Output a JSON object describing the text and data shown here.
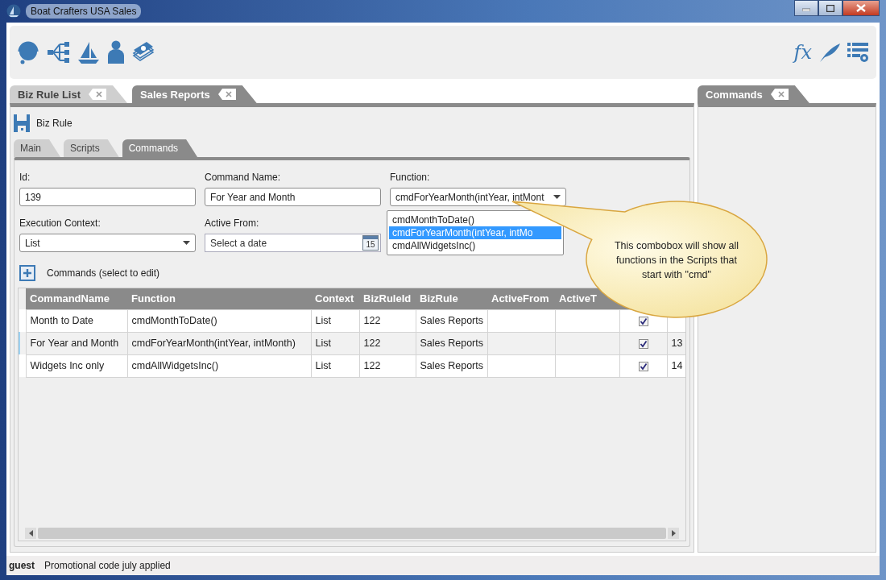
{
  "window": {
    "title": "Boat Crafters USA Sales"
  },
  "toolbar": {
    "formula_label": "fx"
  },
  "document_tabs": [
    {
      "label": "Biz Rule List",
      "selected": false
    },
    {
      "label": "Sales Reports",
      "selected": true
    }
  ],
  "panel_header": {
    "title": "Biz Rule"
  },
  "sub_tabs": [
    {
      "label": "Main",
      "selected": false
    },
    {
      "label": "Scripts",
      "selected": false
    },
    {
      "label": "Commands",
      "selected": true
    }
  ],
  "form": {
    "fields": [
      {
        "kind": "text",
        "label": "Id:",
        "value": "139"
      },
      {
        "kind": "text",
        "label": "Command Name:",
        "value": "For Year and Month"
      },
      {
        "kind": "combo",
        "label": "Function:",
        "value": "cmdForYearMonth(intYear, intMont"
      },
      {
        "kind": "combo",
        "label": "Execution Context:",
        "value": "List"
      },
      {
        "kind": "date",
        "label": "Active From:",
        "placeholder": "Select a date",
        "calendar_day": "15"
      }
    ],
    "function_options": [
      {
        "label": "cmdMonthToDate()",
        "selected": false
      },
      {
        "label": "cmdForYearMonth(intYear, intMo",
        "selected": true
      },
      {
        "label": "cmdAllWidgetsInc()",
        "selected": false
      }
    ]
  },
  "commands": {
    "title": "Commands (select to edit)",
    "columns": [
      "CommandName",
      "Function",
      "Context",
      "BizRuleId",
      "BizRule",
      "ActiveFrom",
      "ActiveT"
    ],
    "rows": [
      {
        "command_name": "Month to Date",
        "function": "cmdMonthToDate()",
        "context": "List",
        "biz_rule_id": "122",
        "biz_rule": "Sales Reports",
        "checked": true,
        "selected": false
      },
      {
        "command_name": "For Year and Month",
        "function": "cmdForYearMonth(intYear, intMonth)",
        "context": "List",
        "biz_rule_id": "122",
        "biz_rule": "Sales Reports",
        "checked": true,
        "column_10": "13",
        "selected": true
      },
      {
        "command_name": "Widgets Inc only",
        "function": "cmdAllWidgetsInc()",
        "context": "List",
        "biz_rule_id": "122",
        "biz_rule": "Sales Reports",
        "checked": true,
        "column_10": "14",
        "selected": false
      }
    ]
  },
  "callout": {
    "text": "This combobox will show all functions in the Scripts that start with \"cmd\""
  },
  "side_tabs": [
    {
      "label": "Commands",
      "selected": true
    }
  ],
  "status_bar": {
    "user": "guest",
    "message": "Promotional code july applied"
  }
}
